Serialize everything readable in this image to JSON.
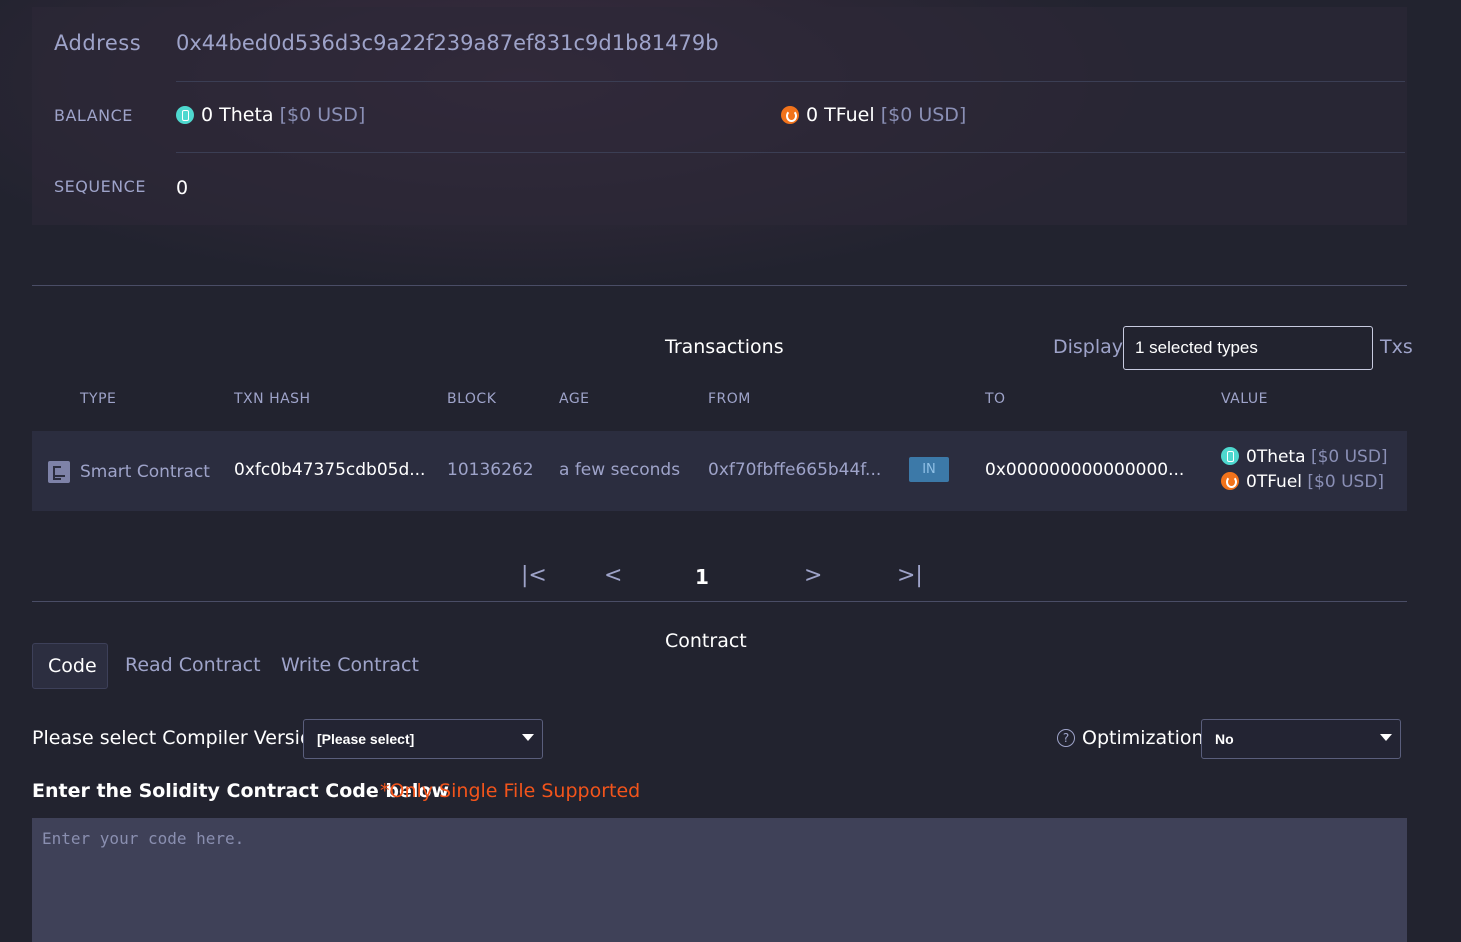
{
  "account": {
    "address_label": "Address",
    "address": "0x44bed0d536d3c9a22f239a87ef831c9d1b81479b",
    "balance_label": "BALANCE",
    "theta_amount": "0 Theta",
    "theta_usd": "[$0 USD]",
    "tfuel_amount": "0 TFuel",
    "tfuel_usd": "[$0 USD]",
    "sequence_label": "SEQUENCE",
    "sequence": "0"
  },
  "transactions": {
    "title": "Transactions",
    "display_label": "Display",
    "filter_value": "1 selected types",
    "txs_label": "Txs",
    "columns": [
      "TYPE",
      "TXN HASH",
      "BLOCK",
      "AGE",
      "FROM",
      "TO",
      "VALUE"
    ],
    "rows": [
      {
        "type": "Smart Contract",
        "hash": "0xfc0b47375cdb05d...",
        "block": "10136262",
        "age": "a few seconds",
        "from": "0xf70fbffe665b44f...",
        "direction": "IN",
        "to": "0x000000000000000...",
        "theta_value": "0Theta",
        "theta_usd": "[$0 USD]",
        "tfuel_value": "0TFuel",
        "tfuel_usd": "[$0 USD]"
      }
    ]
  },
  "pagination": {
    "first": "|<",
    "prev": "<",
    "current": "1",
    "next": ">",
    "last": ">|"
  },
  "contract": {
    "title": "Contract",
    "tabs": [
      "Code",
      "Read Contract",
      "Write Contract"
    ],
    "active_tab": "Code",
    "compiler_label": "Please select Compiler Version",
    "compiler_value": "[Please select]",
    "optimization_help_icon": "?",
    "optimization_label": "Optimization",
    "optimization_value": "No",
    "code_label": "Enter the Solidity Contract Code below",
    "code_note": "*Only Single File Supported",
    "code_placeholder": "Enter your code here."
  },
  "colors": {
    "accent_orange": "#f2541b",
    "theta_teal": "#4ed8cf",
    "tfuel_orange": "#f2731b",
    "in_badge": "#3c79a8"
  },
  "icons": [
    "theta-coin-icon",
    "tfuel-coin-icon",
    "smart-contract-icon",
    "caret-down-icon",
    "help-icon"
  ]
}
